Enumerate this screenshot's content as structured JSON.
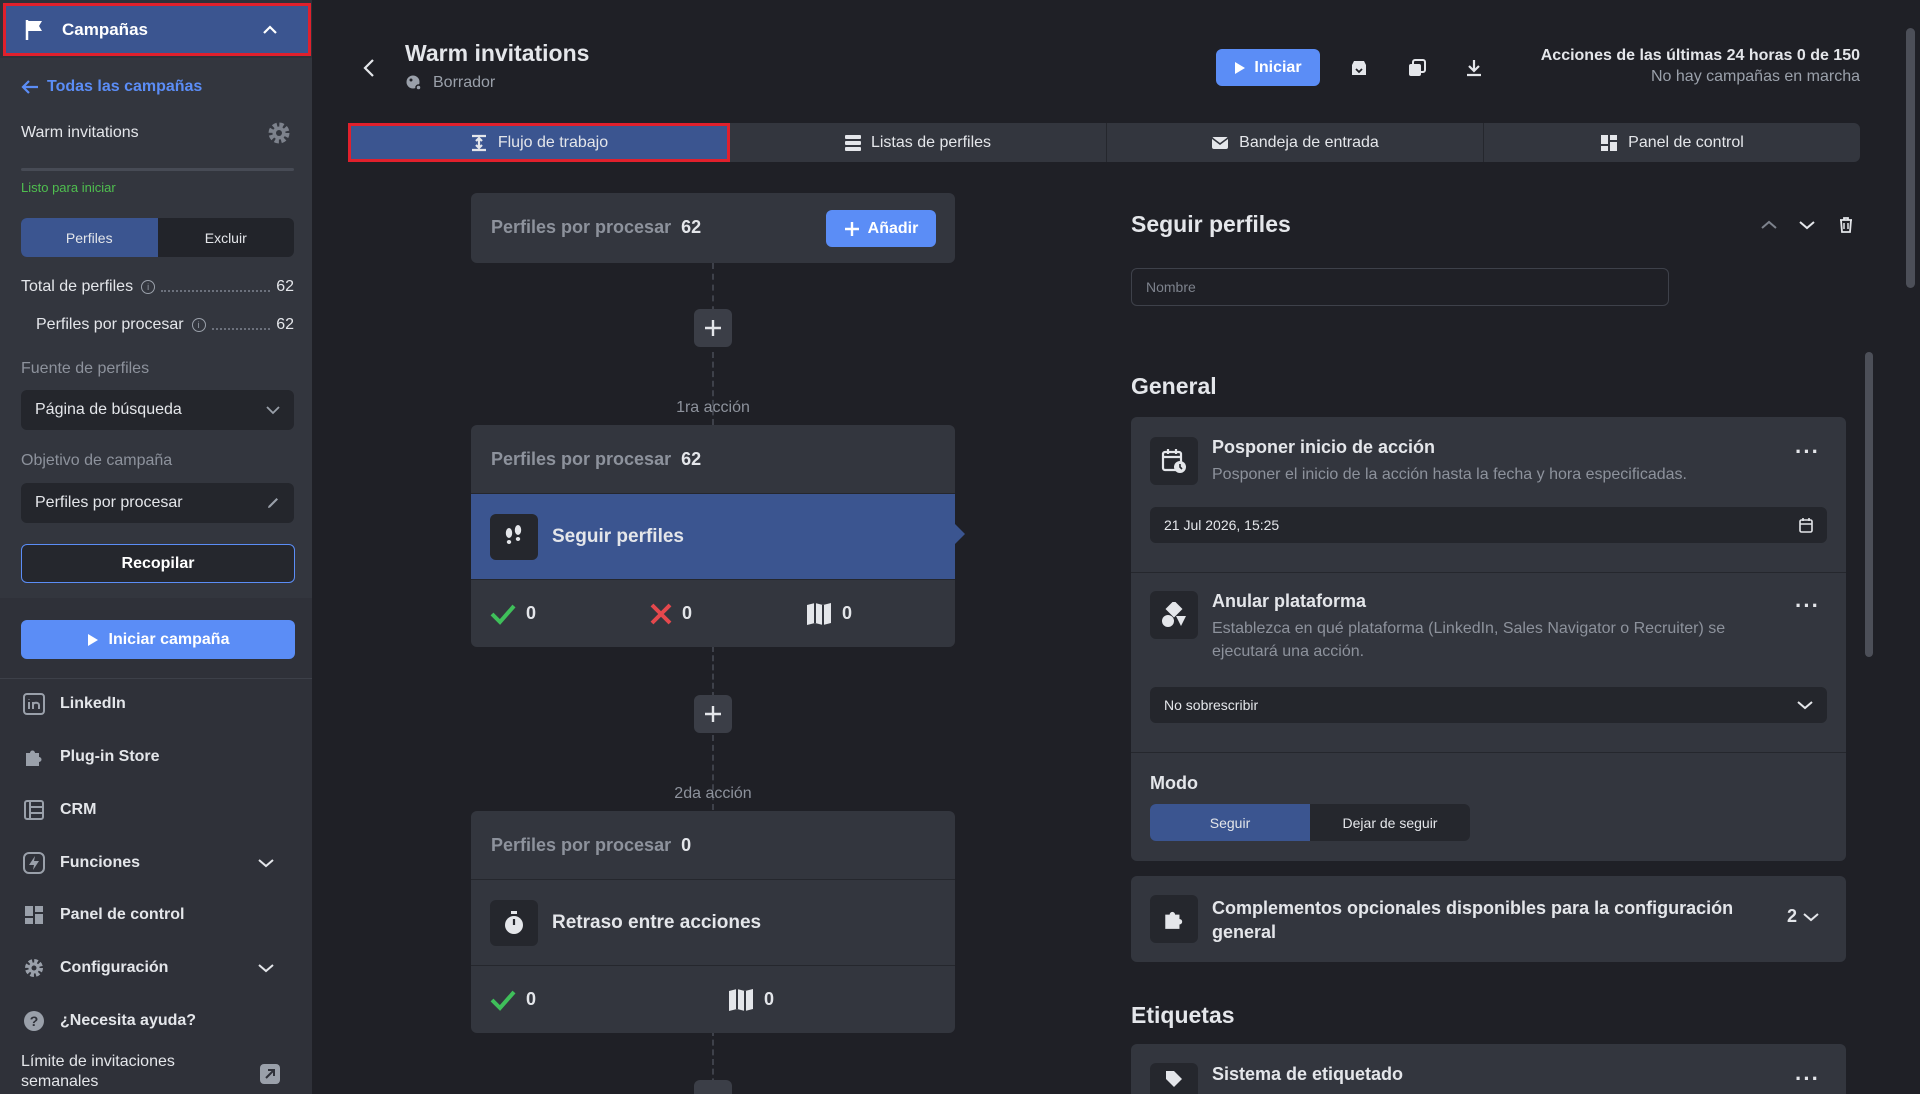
{
  "sidebar": {
    "header_title": "Campañas",
    "back_link": "Todas las campañas",
    "campaign_name": "Warm invitations",
    "status": "Listo para iniciar",
    "segment": [
      "Perfiles",
      "Excluir"
    ],
    "total_label": "Total de perfiles",
    "total_value": "62",
    "to_process_label": "Perfiles por procesar",
    "to_process_value": "62",
    "source_label": "Fuente de perfiles",
    "source_value": "Página de búsqueda",
    "goal_label": "Objetivo de campaña",
    "goal_value": "Perfiles por procesar",
    "collect_button": "Recopilar",
    "start_button": "Iniciar campaña",
    "nav": [
      "LinkedIn",
      "Plug-in Store",
      "CRM",
      "Funciones",
      "Panel de control",
      "Configuración",
      "¿Necesita ayuda?"
    ],
    "limit_label": "Límite de invitaciones semanales"
  },
  "header": {
    "title": "Warm invitations",
    "subtitle": "Borrador",
    "start_button": "Iniciar",
    "actions_line1": "Acciones de las últimas 24 horas 0 de 150",
    "actions_line2": "No hay campañas en marcha"
  },
  "tabs": [
    "Flujo de trabajo",
    "Listas de perfiles",
    "Bandeja de entrada",
    "Panel de control"
  ],
  "workflow": {
    "top_card": {
      "label": "Perfiles por procesar",
      "count": "62",
      "add_button": "Añadir"
    },
    "steps": [
      {
        "step_label": "1ra acción",
        "to_process_label": "Perfiles por procesar",
        "to_process_count": "62",
        "action_name": "Seguir perfiles",
        "success": "0",
        "fail": "0",
        "skipped": "0"
      },
      {
        "step_label": "2da acción",
        "to_process_label": "Perfiles por procesar",
        "to_process_count": "0",
        "action_name": "Retraso entre acciones",
        "success": "0",
        "skipped": "0"
      }
    ]
  },
  "detail": {
    "title": "Seguir perfiles",
    "name_placeholder": "Nombre",
    "general_title": "General",
    "postpone_title": "Posponer inicio de acción",
    "postpone_desc": "Posponer el inicio de la acción hasta la fecha y hora especificadas.",
    "postpone_value": "21 Jul 2026, 15:25",
    "platform_title": "Anular plataforma",
    "platform_desc": "Establezca en qué plataforma (LinkedIn, Sales Navigator o Recruiter) se ejecutará una acción.",
    "platform_value": "No sobrescribir",
    "mode_label": "Modo",
    "mode_options": [
      "Seguir",
      "Dejar de seguir"
    ],
    "addons_title": "Complementos opcionales disponibles para la configuración general",
    "addons_count": "2",
    "tags_title": "Etiquetas",
    "tagging_title": "Sistema de etiquetado"
  },
  "colors": {
    "accent": "#5b8df6",
    "selected": "#3b5590",
    "success": "#3fbf5a",
    "fail": "#e5484d",
    "highlight": "#e0202c"
  }
}
